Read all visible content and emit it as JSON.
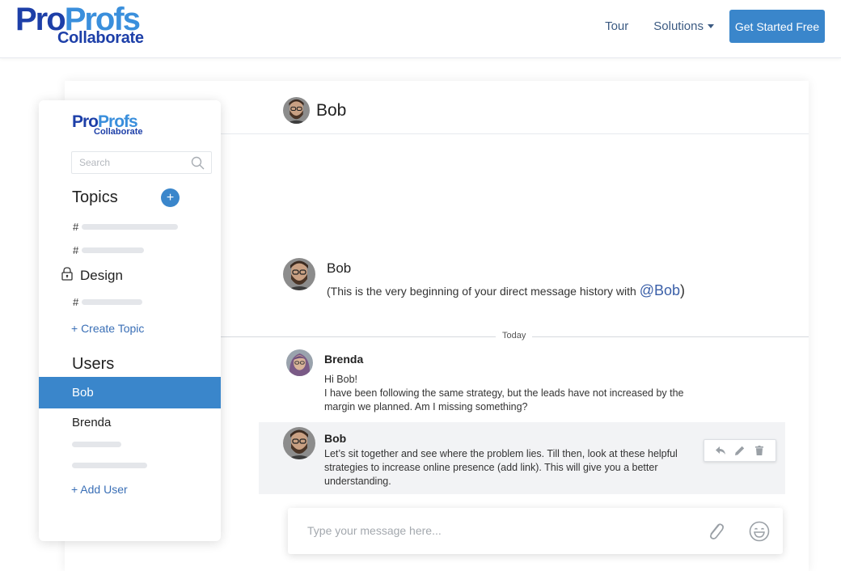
{
  "brand": {
    "logo_part1": "Pro",
    "logo_part2": "Profs",
    "logo_sub": "Collaborate"
  },
  "nav": {
    "tour": "Tour",
    "solutions": "Solutions",
    "cta": "Get Started Free"
  },
  "sidebar": {
    "search_placeholder": "Search",
    "topics_title": "Topics",
    "add_topic_symbol": "+",
    "topic_hash": "#",
    "locked_topic": "Design",
    "create_topic": "+ Create Topic",
    "users_title": "Users",
    "users": [
      "Bob",
      "Brenda"
    ],
    "add_user": "+ Add User"
  },
  "chat": {
    "header_name": "Bob",
    "intro_name": "Bob",
    "intro_text_before": "(This is the very beginning of your direct message history with ",
    "intro_mention": "@Bob",
    "intro_text_after": ")",
    "divider_label": "Today",
    "messages": [
      {
        "author": "Brenda",
        "lines": [
          "Hi Bob!",
          "I have been following the same strategy, but the leads have not increased by the",
          "margin we planned. Am I missing something?"
        ]
      },
      {
        "author": "Bob",
        "lines": [
          "Let’s sit together and see where the problem lies. Till then, look at these helpful",
          "strategies to increase online presence (add link). This will give you a better",
          "understanding."
        ]
      }
    ],
    "composer_placeholder": "Type your message here..."
  },
  "colors": {
    "accent": "#3a86cb",
    "brand_dark": "#1d3fa8",
    "brand_light": "#3a8fdc",
    "link": "#3a6fb6"
  },
  "icons": {
    "search": "search-icon",
    "lock": "lock-icon",
    "reply": "reply-icon",
    "edit": "pencil-icon",
    "delete": "trash-icon",
    "attach": "paperclip-icon",
    "emoji": "smiley-icon"
  }
}
